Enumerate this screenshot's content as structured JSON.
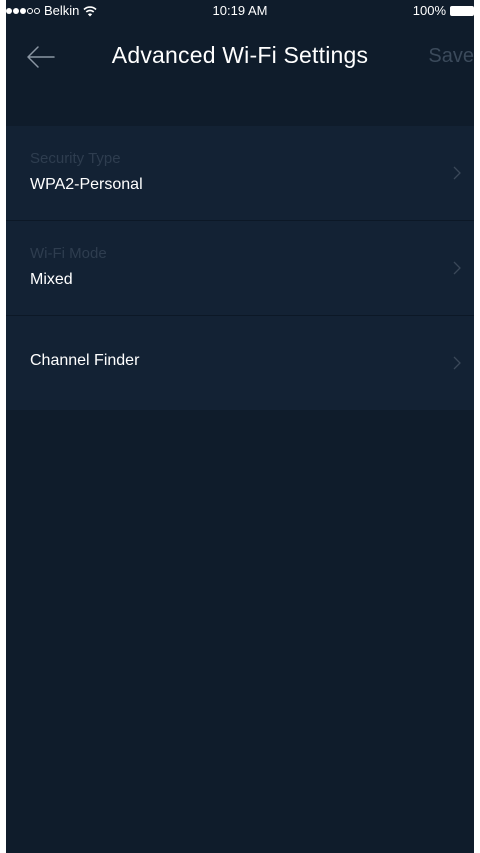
{
  "status_bar": {
    "carrier": "Belkin",
    "time": "10:19 AM",
    "battery": "100%",
    "signal_bars_filled": 3,
    "signal_bars_total": 5
  },
  "header": {
    "back_icon": "back-arrow-icon",
    "title": "Advanced Wi-Fi Settings",
    "save_label": "Save"
  },
  "settings": [
    {
      "label": "Security Type",
      "value": "WPA2-Personal"
    },
    {
      "label": "Wi-Fi Mode",
      "value": "Mixed"
    },
    {
      "label": "",
      "value": "Channel Finder"
    }
  ],
  "colors": {
    "background": "#0f1c2b",
    "row_background": "#132234",
    "disabled_text": "#2e3d4f",
    "save_disabled": "#3b4a5b"
  }
}
